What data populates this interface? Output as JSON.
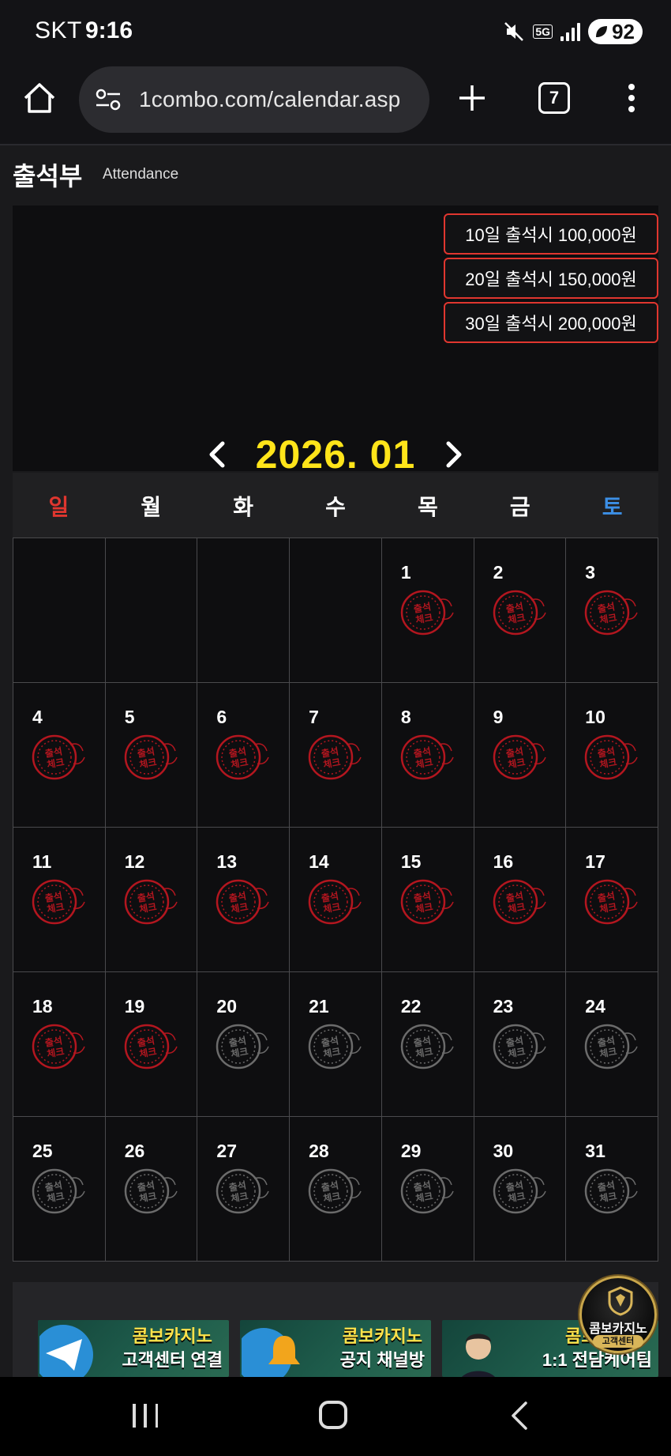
{
  "status_bar": {
    "carrier": "SKT",
    "time": "9:16",
    "network": "5G",
    "battery": "92"
  },
  "browser": {
    "url": "1combo.com/calendar.asp",
    "tab_count": "7"
  },
  "header": {
    "title": "출석부",
    "subtitle": "Attendance"
  },
  "rewards": [
    "10일 출석시 100,000원",
    "20일 출석시 150,000원",
    "30일 출석시 200,000원"
  ],
  "calendar": {
    "month_label": "2026. 01",
    "weekdays": [
      "일",
      "월",
      "화",
      "수",
      "목",
      "금",
      "토"
    ],
    "weekday_colors": [
      "#e0362f",
      "#ffffff",
      "#ffffff",
      "#ffffff",
      "#ffffff",
      "#ffffff",
      "#3c8fe6"
    ],
    "stamp_text_top": "출석",
    "stamp_text_bottom": "체크",
    "stamp_checked_color": "#b3161f",
    "stamp_unchecked_color": "#6b6b6b",
    "leading_blank_days": 4,
    "total_days": 31,
    "checked_days": [
      1,
      2,
      3,
      4,
      5,
      6,
      7,
      8,
      9,
      10,
      11,
      12,
      13,
      14,
      15,
      16,
      17,
      18,
      19
    ]
  },
  "banners": [
    {
      "line1": "콤보카지노",
      "line2": "고객센터 연결"
    },
    {
      "line1": "콤보카지노",
      "line2": "공지 채널방"
    },
    {
      "line1": "콤보카지",
      "line2": "1:1 전담케어팀"
    }
  ],
  "cs_badge": {
    "title": "콤보카지노",
    "subtitle": "고객센터"
  }
}
